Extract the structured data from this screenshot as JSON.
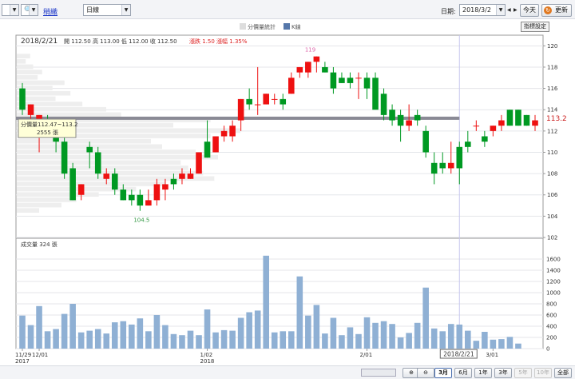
{
  "toolbar": {
    "symbol_box": "",
    "link_label": "稍織",
    "period_select": "日線",
    "date_label": "日期:",
    "date_value": "2018/3/2",
    "today_button": "今天",
    "refresh_button": "更新",
    "prev_arrow": "◀",
    "next_arrow": "▶"
  },
  "legend": {
    "item1": "分價量統計",
    "item2": "K線",
    "item1_color": "#dddddd",
    "item2_color": "#5577aa"
  },
  "settings_button": "指標設定",
  "info": {
    "date": "2018/2/21",
    "open_label": "開",
    "open": "112.50",
    "high_label": "高",
    "high": "113.00",
    "low_label": "低",
    "low": "112.00",
    "close_label": "收",
    "close": "112.50",
    "change_label": "漲跌",
    "change": "1.50",
    "pct_label": "漲幅",
    "pct": "1.35%"
  },
  "tooltip": {
    "line1": "分價量112.47~113.2",
    "line2": "2555 張"
  },
  "volume_label": "成交量 324 張",
  "colors": {
    "up": "#ee1111",
    "down": "#009922",
    "volume": "#8fb0d4",
    "grid": "#e4e6ea",
    "axis": "#999999",
    "price_line": "#8a8a95",
    "cursor": "#c7c7ee",
    "profile": "#eeeeee"
  },
  "chart_data": {
    "type": "candlestick",
    "price_ylim": [
      102,
      121
    ],
    "price_ticks": [
      "102",
      "104",
      "106",
      "108",
      "110",
      "112",
      "114",
      "116",
      "118",
      "120"
    ],
    "volume_ylim": [
      0,
      1800
    ],
    "volume_ticks": [
      "0",
      "200",
      "400",
      "600",
      "800",
      "1000",
      "1200",
      "1400",
      "1600"
    ],
    "current_price": "113.2",
    "current_price_value": 113.2,
    "high_annotation": "119",
    "high_annotation_value": 119,
    "high_annotation_index": 34,
    "low_annotation": "104.5",
    "low_annotation_value": 104.5,
    "low_annotation_index": 14,
    "selected_index": 52,
    "selected_date": "2018/2/21",
    "x_labels": [
      {
        "index": 0,
        "line1": "11/29",
        "line2": "2017"
      },
      {
        "index": 2,
        "line1": "12/01",
        "line2": ""
      },
      {
        "index": 22,
        "line1": "1/02",
        "line2": "2018"
      },
      {
        "index": 41,
        "line1": "2/01",
        "line2": ""
      },
      {
        "index": 56,
        "line1": "3/01",
        "line2": ""
      }
    ],
    "candles": [
      {
        "o": 116,
        "h": 116.5,
        "l": 113.5,
        "c": 114
      },
      {
        "o": 113.5,
        "h": 114.5,
        "l": 111.5,
        "c": 114.5
      },
      {
        "o": 112.5,
        "h": 113.5,
        "l": 110,
        "c": 113.5
      },
      {
        "o": 113,
        "h": 113.5,
        "l": 111.5,
        "c": 112
      },
      {
        "o": 111.5,
        "h": 112,
        "l": 110,
        "c": 111
      },
      {
        "o": 111,
        "h": 111.5,
        "l": 107.5,
        "c": 108
      },
      {
        "o": 108.5,
        "h": 109,
        "l": 105.5,
        "c": 105.5
      },
      {
        "o": 106,
        "h": 107,
        "l": 105.5,
        "c": 107
      },
      {
        "o": 110.5,
        "h": 111,
        "l": 108.5,
        "c": 110
      },
      {
        "o": 110,
        "h": 110.5,
        "l": 107.5,
        "c": 108
      },
      {
        "o": 107.5,
        "h": 108.5,
        "l": 107,
        "c": 108
      },
      {
        "o": 108,
        "h": 108.5,
        "l": 106,
        "c": 106.5
      },
      {
        "o": 106.5,
        "h": 107,
        "l": 105.5,
        "c": 105.5
      },
      {
        "o": 106,
        "h": 106.5,
        "l": 105,
        "c": 105.5
      },
      {
        "o": 106,
        "h": 106.5,
        "l": 104.5,
        "c": 105
      },
      {
        "o": 105,
        "h": 106.5,
        "l": 105,
        "c": 105.5
      },
      {
        "o": 105.5,
        "h": 107.5,
        "l": 105,
        "c": 107
      },
      {
        "o": 106.5,
        "h": 107.5,
        "l": 105.5,
        "c": 107
      },
      {
        "o": 107.5,
        "h": 108,
        "l": 106.5,
        "c": 107
      },
      {
        "o": 107.5,
        "h": 108.5,
        "l": 107,
        "c": 108
      },
      {
        "o": 107.5,
        "h": 108.5,
        "l": 107.5,
        "c": 108
      },
      {
        "o": 108,
        "h": 110,
        "l": 108,
        "c": 110
      },
      {
        "o": 111,
        "h": 113,
        "l": 109.5,
        "c": 109.5
      },
      {
        "o": 110,
        "h": 111.5,
        "l": 110,
        "c": 111.5
      },
      {
        "o": 111.5,
        "h": 112.5,
        "l": 111,
        "c": 112
      },
      {
        "o": 111.5,
        "h": 113,
        "l": 111,
        "c": 112.5
      },
      {
        "o": 113,
        "h": 115,
        "l": 112,
        "c": 115
      },
      {
        "o": 115,
        "h": 116,
        "l": 114,
        "c": 114.5
      },
      {
        "o": 114.5,
        "h": 118,
        "l": 113.5,
        "c": 114.5
      },
      {
        "o": 114.5,
        "h": 115.5,
        "l": 114.5,
        "c": 115.5
      },
      {
        "o": 115,
        "h": 115.5,
        "l": 114.5,
        "c": 115
      },
      {
        "o": 115,
        "h": 115.5,
        "l": 114,
        "c": 114.5
      },
      {
        "o": 115.5,
        "h": 117.5,
        "l": 115.5,
        "c": 117
      },
      {
        "o": 117.5,
        "h": 118,
        "l": 117,
        "c": 118
      },
      {
        "o": 117.5,
        "h": 118.5,
        "l": 117,
        "c": 118.5
      },
      {
        "o": 118.5,
        "h": 119,
        "l": 117.5,
        "c": 119
      },
      {
        "o": 118,
        "h": 118.5,
        "l": 117.5,
        "c": 117.5
      },
      {
        "o": 117.5,
        "h": 118,
        "l": 115.5,
        "c": 116
      },
      {
        "o": 117,
        "h": 117.5,
        "l": 116.5,
        "c": 116.5
      },
      {
        "o": 117,
        "h": 117.5,
        "l": 116,
        "c": 116.5
      },
      {
        "o": 117,
        "h": 117.5,
        "l": 115,
        "c": 117
      },
      {
        "o": 117,
        "h": 117.5,
        "l": 115,
        "c": 116
      }
    ],
    "candles_tail": [
      {
        "o": 117,
        "h": 117.5,
        "l": 115,
        "c": 114
      },
      {
        "o": 115.5,
        "h": 116,
        "l": 113,
        "c": 113.5
      },
      {
        "o": 114,
        "h": 114.5,
        "l": 112.5,
        "c": 113
      },
      {
        "o": 113.5,
        "h": 114,
        "l": 111,
        "c": 112.5
      },
      {
        "o": 112.5,
        "h": 114.5,
        "l": 112,
        "c": 113
      },
      {
        "o": 113.5,
        "h": 114,
        "l": 112.5,
        "c": 113
      },
      {
        "o": 112,
        "h": 112.5,
        "l": 109.5,
        "c": 110
      },
      {
        "o": 109,
        "h": 110,
        "l": 107,
        "c": 108
      },
      {
        "o": 109,
        "h": 110,
        "l": 108,
        "c": 108.5
      },
      {
        "o": 108.5,
        "h": 111,
        "l": 108,
        "c": 109
      },
      {
        "o": 110.5,
        "h": 111,
        "l": 107,
        "c": 108.5
      },
      {
        "o": 111,
        "h": 112,
        "l": 110,
        "c": 110.5
      },
      {
        "o": 112.5,
        "h": 113,
        "l": 112,
        "c": 112.5
      },
      {
        "o": 111.5,
        "h": 112,
        "l": 110.5,
        "c": 111
      },
      {
        "o": 112,
        "h": 112.5,
        "l": 111.5,
        "c": 112.5
      },
      {
        "o": 112.5,
        "h": 113.5,
        "l": 112,
        "c": 113
      },
      {
        "o": 114,
        "h": 114,
        "l": 112.5,
        "c": 112.5
      },
      {
        "o": 114,
        "h": 114,
        "l": 112.5,
        "c": 112.5
      },
      {
        "o": 113.5,
        "h": 113.5,
        "l": 112.5,
        "c": 112.5
      },
      {
        "o": 112.5,
        "h": 113.5,
        "l": 112,
        "c": 113
      }
    ],
    "volume": [
      590,
      420,
      760,
      310,
      350,
      620,
      800,
      290,
      320,
      350,
      270,
      470,
      490,
      430,
      540,
      310,
      600,
      420,
      260,
      240,
      320,
      240,
      700,
      290,
      330,
      320,
      550,
      650,
      680,
      1660,
      290,
      310,
      310,
      1290,
      590,
      780,
      270,
      550,
      240,
      380,
      260,
      560,
      460,
      490,
      440,
      200,
      280,
      460,
      1090,
      360,
      310,
      440,
      430,
      320,
      140,
      300,
      160,
      170,
      210,
      90
    ],
    "price_profile": [
      {
        "p": 119.0,
        "w": 18
      },
      {
        "p": 118.5,
        "w": 12
      },
      {
        "p": 118.0,
        "w": 22
      },
      {
        "p": 117.5,
        "w": 34
      },
      {
        "p": 117.0,
        "w": 28
      },
      {
        "p": 116.5,
        "w": 64
      },
      {
        "p": 116.0,
        "w": 48
      },
      {
        "p": 115.5,
        "w": 72
      },
      {
        "p": 115.0,
        "w": 52
      },
      {
        "p": 114.5,
        "w": 88
      },
      {
        "p": 114.0,
        "w": 120
      },
      {
        "p": 113.5,
        "w": 140
      },
      {
        "p": 113.0,
        "w": 260
      },
      {
        "p": 112.5,
        "w": 210
      },
      {
        "p": 112.0,
        "w": 300
      },
      {
        "p": 111.5,
        "w": 260
      },
      {
        "p": 111.0,
        "w": 180
      },
      {
        "p": 110.5,
        "w": 195
      },
      {
        "p": 110.0,
        "w": 240
      },
      {
        "p": 109.5,
        "w": 270
      },
      {
        "p": 109.0,
        "w": 220
      },
      {
        "p": 108.5,
        "w": 230
      },
      {
        "p": 108.0,
        "w": 250
      },
      {
        "p": 107.5,
        "w": 265
      },
      {
        "p": 107.0,
        "w": 200
      },
      {
        "p": 106.5,
        "w": 160
      },
      {
        "p": 106.0,
        "w": 110
      },
      {
        "p": 105.5,
        "w": 80
      },
      {
        "p": 105.0,
        "w": 60
      },
      {
        "p": 104.5,
        "w": 30
      }
    ]
  },
  "range_buttons": {
    "r3m": "3月",
    "r6m": "6月",
    "r1y": "1年",
    "r3y": "3年",
    "r5y": "5年",
    "r10y": "10年",
    "all": "全部"
  }
}
